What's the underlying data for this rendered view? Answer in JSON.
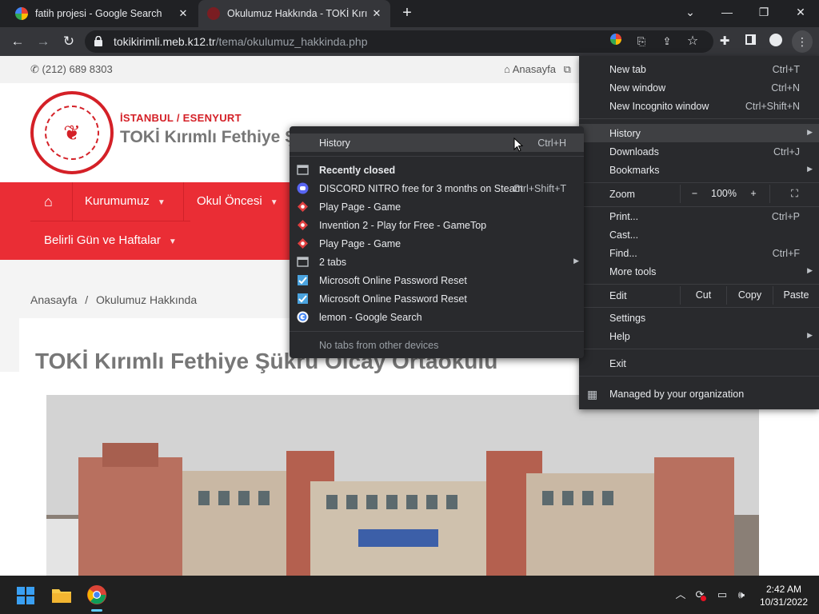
{
  "tabs": [
    {
      "title": "fatih projesi - Google Search",
      "close": "✕"
    },
    {
      "title": "Okulumuz Hakkında - TOKİ Kırımlı",
      "close": "✕"
    }
  ],
  "new_tab": "+",
  "window_controls": {
    "minimize": "⌄",
    "restore": "—",
    "maximize": "❐",
    "close": "✕"
  },
  "address": {
    "host": "tokikirimli.meb.k12.tr",
    "path": "/tema/okulumuz_hakkinda.php"
  },
  "page": {
    "phone": "(212) 689 8303",
    "home_link": "Anasayfa",
    "city": "İSTANBUL / ESENYURT",
    "school_name_visible": "TOKİ Kırımlı Fethiye Ş",
    "nav": [
      {
        "label": "Kurumumuz"
      },
      {
        "label": "Okul Öncesi"
      },
      {
        "label": "Belirli Gün ve Haftalar"
      }
    ],
    "breadcrumb": [
      "Anasayfa",
      "/",
      "Okulumuz Hakkında"
    ],
    "heading": "TOKİ Kırımlı Fethiye Şükrü Olcay Ortaokulu"
  },
  "main_menu": {
    "new_tab": {
      "label": "New tab",
      "shortcut": "Ctrl+T"
    },
    "new_window": {
      "label": "New window",
      "shortcut": "Ctrl+N"
    },
    "incognito": {
      "label": "New Incognito window",
      "shortcut": "Ctrl+Shift+N"
    },
    "history": {
      "label": "History"
    },
    "downloads": {
      "label": "Downloads",
      "shortcut": "Ctrl+J"
    },
    "bookmarks": {
      "label": "Bookmarks"
    },
    "zoom": {
      "label": "Zoom",
      "minus": "−",
      "value": "100%",
      "plus": "+"
    },
    "print": {
      "label": "Print...",
      "shortcut": "Ctrl+P"
    },
    "cast": {
      "label": "Cast..."
    },
    "find": {
      "label": "Find...",
      "shortcut": "Ctrl+F"
    },
    "more_tools": {
      "label": "More tools"
    },
    "edit": {
      "label": "Edit",
      "cut": "Cut",
      "copy": "Copy",
      "paste": "Paste"
    },
    "settings": {
      "label": "Settings"
    },
    "help": {
      "label": "Help"
    },
    "exit": {
      "label": "Exit"
    },
    "managed": {
      "label": "Managed by your organization"
    }
  },
  "history_menu": {
    "history": {
      "label": "History",
      "shortcut": "Ctrl+H"
    },
    "recently_closed": "Recently closed",
    "items": [
      {
        "label": "DISCORD NITRO free for 3 months on Steam",
        "shortcut": "Ctrl+Shift+T",
        "icon": "discord-icon",
        "color": "#5865f2"
      },
      {
        "label": "Play Page - Game",
        "icon": "game-icon",
        "color": "#e04040"
      },
      {
        "label": "Invention 2 - Play for Free - GameTop",
        "icon": "game-icon",
        "color": "#e04040"
      },
      {
        "label": "Play Page - Game",
        "icon": "game-icon",
        "color": "#e04040"
      },
      {
        "label": "2 tabs",
        "icon": "window-icon",
        "color": "#bdc1c6"
      },
      {
        "label": "Microsoft Online Password Reset",
        "icon": "microsoft-icon",
        "color": "#4aa3df"
      },
      {
        "label": "Microsoft Online Password Reset",
        "icon": "microsoft-icon",
        "color": "#4aa3df"
      },
      {
        "label": "lemon - Google Search",
        "icon": "google-icon",
        "color": "#ffffff"
      }
    ],
    "no_tabs": "No tabs from other devices"
  },
  "taskbar": {
    "time": "2:42 AM",
    "date": "10/31/2022"
  },
  "colors": {
    "brand_red": "#ea2d35",
    "menu_bg": "#292a2d"
  }
}
